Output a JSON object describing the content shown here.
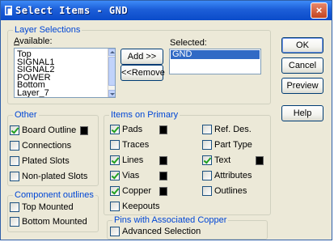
{
  "window": {
    "title": "Select Items - GND",
    "close_glyph": "×"
  },
  "layer_selections": {
    "legend": "Layer Selections",
    "available_label": "Available:",
    "available_items": [
      "Top",
      "SIGNAL1",
      "SIGNAL2",
      "POWER",
      "Bottom",
      "Layer_7"
    ],
    "selected_label": "Selected:",
    "selected_items": [
      "GND"
    ],
    "add_button": "Add >>",
    "remove_button": "<<Remove"
  },
  "buttons": {
    "ok": "OK",
    "cancel": "Cancel",
    "preview": "Preview",
    "help": "Help"
  },
  "other": {
    "legend": "Other",
    "items": [
      {
        "label": "Board Outline",
        "checked": true,
        "swatch": true
      },
      {
        "label": "Connections",
        "checked": false
      },
      {
        "label": "Plated Slots",
        "checked": false
      },
      {
        "label": "Non-plated Slots",
        "checked": false
      }
    ]
  },
  "items_on_primary": {
    "legend": "Items on Primary",
    "left": [
      {
        "label": "Pads",
        "checked": true,
        "swatch": true
      },
      {
        "label": "Traces",
        "checked": false
      },
      {
        "label": "Lines",
        "checked": true,
        "swatch": true
      },
      {
        "label": "Vias",
        "checked": true,
        "swatch": true
      },
      {
        "label": "Copper",
        "checked": true,
        "swatch": true
      },
      {
        "label": "Keepouts",
        "checked": false
      }
    ],
    "right": [
      {
        "label": "Ref. Des.",
        "checked": false
      },
      {
        "label": "Part Type",
        "checked": false
      },
      {
        "label": "Text",
        "checked": true,
        "swatch": true
      },
      {
        "label": "Attributes",
        "checked": false
      },
      {
        "label": "Outlines",
        "checked": false
      }
    ]
  },
  "component_outlines": {
    "legend": "Component outlines",
    "items": [
      {
        "label": "Top Mounted",
        "checked": false
      },
      {
        "label": "Bottom Mounted",
        "checked": false
      }
    ]
  },
  "pins_with_copper": {
    "legend": "Pins with Associated Copper",
    "items": [
      {
        "label": "Advanced Selection",
        "checked": false
      }
    ]
  },
  "colors": {
    "title_bar": "#0a4bc9",
    "group_legend": "#0046d5",
    "selection": "#316ac5",
    "swatch": "#000000"
  }
}
